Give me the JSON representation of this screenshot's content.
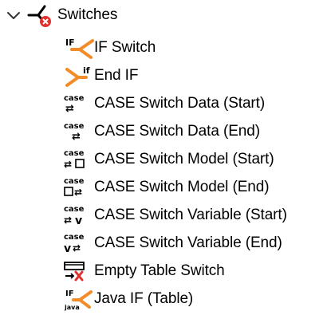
{
  "tree": {
    "root": {
      "label": "Switches",
      "expanded": true,
      "icon": "switch-category-icon"
    },
    "items": [
      {
        "label": "IF Switch",
        "icon": "if-switch-icon",
        "icon_text": "IF"
      },
      {
        "label": "End IF",
        "icon": "end-if-icon",
        "icon_text": "if"
      },
      {
        "label": "CASE Switch Data (Start)",
        "icon": "case-switch-data-start-icon",
        "icon_text": "case"
      },
      {
        "label": "CASE Switch Data (End)",
        "icon": "case-switch-data-end-icon",
        "icon_text": "case"
      },
      {
        "label": "CASE Switch Model (Start)",
        "icon": "case-switch-model-start-icon",
        "icon_text": "case"
      },
      {
        "label": "CASE Switch Model (End)",
        "icon": "case-switch-model-end-icon",
        "icon_text": "case"
      },
      {
        "label": "CASE Switch Variable (Start)",
        "icon": "case-switch-variable-start-icon",
        "icon_text": "case"
      },
      {
        "label": "CASE Switch Variable (End)",
        "icon": "case-switch-variable-end-icon",
        "icon_text": "case"
      },
      {
        "label": "Empty Table Switch",
        "icon": "empty-table-switch-icon"
      },
      {
        "label": "Java IF (Table)",
        "icon": "java-if-table-icon",
        "icon_text": "IF",
        "icon_subtext": "java"
      }
    ],
    "colors": {
      "orange": "#f28c28",
      "red": "#e0312f",
      "black": "#000000"
    }
  }
}
